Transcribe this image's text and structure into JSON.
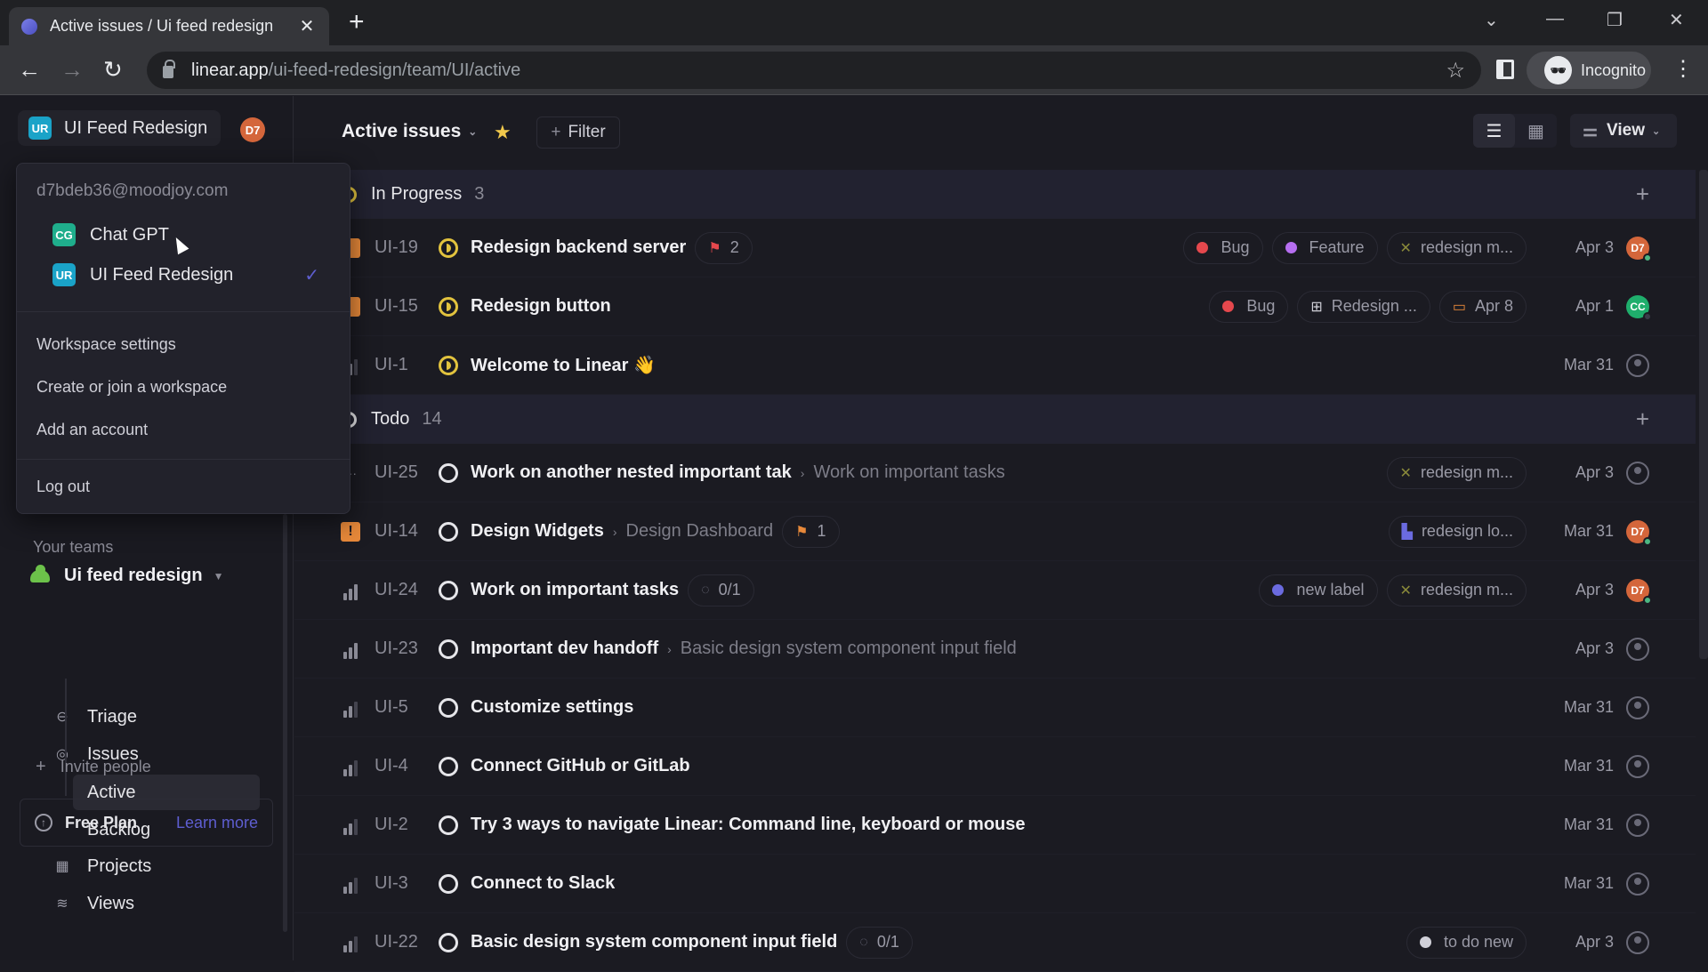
{
  "browser": {
    "tab_title": "Active issues / Ui feed redesign",
    "url_host": "linear.app",
    "url_path": "/ui-feed-redesign/team/UI/active",
    "profile_label": "Incognito"
  },
  "workspace": {
    "badge": "UR",
    "name": "UI Feed Redesign",
    "user_initials": "D7"
  },
  "workspace_menu": {
    "email": "d7bdeb36@moodjoy.com",
    "workspaces": [
      {
        "badge": "CG",
        "name": "Chat GPT",
        "color": "#1fae8c",
        "selected": false
      },
      {
        "badge": "UR",
        "name": "UI Feed Redesign",
        "color": "#1aa3c8",
        "selected": true
      }
    ],
    "items": [
      "Workspace settings",
      "Create or join a workspace",
      "Add an account",
      "Log out"
    ]
  },
  "sidebar": {
    "section_label": "Your teams",
    "team_name": "Ui feed redesign",
    "nav": [
      {
        "label": "Triage",
        "icon": "triage-icon"
      },
      {
        "label": "Issues",
        "icon": "issues-icon"
      }
    ],
    "sub_items": [
      {
        "label": "Active",
        "active": true
      },
      {
        "label": "Backlog",
        "active": false
      }
    ],
    "nav_more": [
      {
        "label": "Projects",
        "icon": "projects-icon"
      },
      {
        "label": "Views",
        "icon": "views-icon"
      }
    ],
    "invite_label": "Invite people",
    "plan_label": "Free Plan",
    "learn_more": "Learn more"
  },
  "toolbar": {
    "view_title": "Active issues",
    "filter_label": "Filter",
    "view_label": "View"
  },
  "groups": [
    {
      "name": "In Progress",
      "count": "3",
      "status_color": "#e2c33e",
      "issues": [
        {
          "id": "UI-19",
          "priority": "urgent",
          "status": "prog",
          "title": "Redesign backend server",
          "parent": "",
          "sub": {
            "icon": "milestone-flag",
            "text": "2",
            "color": "#e5484d"
          },
          "labels": [
            {
              "type": "dot",
              "color": "#e5484d",
              "text": "Bug"
            },
            {
              "type": "dot",
              "color": "#b66ef0",
              "text": "Feature"
            },
            {
              "type": "project",
              "text": "redesign m..."
            }
          ],
          "date": "Apr 3",
          "assignee": {
            "initials": "D7",
            "color": "#d4663b",
            "online": true
          }
        },
        {
          "id": "UI-15",
          "priority": "urgent",
          "status": "prog",
          "title": "Redesign button",
          "parent": "",
          "sub": null,
          "labels": [
            {
              "type": "dot",
              "color": "#e5484d",
              "text": "Bug"
            },
            {
              "type": "cycle",
              "text": "Redesign ..."
            },
            {
              "type": "due",
              "text": "Apr 8"
            }
          ],
          "date": "Apr 1",
          "assignee": {
            "initials": "CC",
            "color": "#1fae6c",
            "online": false
          }
        },
        {
          "id": "UI-1",
          "priority": "low",
          "status": "prog",
          "title": "Welcome to Linear 👋",
          "parent": "",
          "sub": null,
          "labels": [],
          "date": "Mar 31",
          "assignee": null
        }
      ]
    },
    {
      "name": "Todo",
      "count": "14",
      "status_color": "#e6e6ea",
      "issues": [
        {
          "id": "UI-25",
          "priority": "none",
          "status": "todo",
          "title": "Work on another nested important tak",
          "parent": "Work on important tasks",
          "sub": null,
          "labels": [
            {
              "type": "project",
              "text": "redesign m..."
            }
          ],
          "date": "Apr 3",
          "assignee": null
        },
        {
          "id": "UI-14",
          "priority": "urgent-bang",
          "status": "todo",
          "title": "Design Widgets",
          "parent": "Design Dashboard",
          "sub": {
            "icon": "milestone-flag",
            "text": "1",
            "color": "#e8893a"
          },
          "labels": [
            {
              "type": "doc",
              "text": "redesign lo..."
            }
          ],
          "date": "Mar 31",
          "assignee": {
            "initials": "D7",
            "color": "#d4663b",
            "online": true
          }
        },
        {
          "id": "UI-24",
          "priority": "medium",
          "status": "todo",
          "title": "Work on important tasks",
          "parent": "",
          "sub": {
            "icon": "progress-ring",
            "text": "0/1",
            "color": "#6a6a78"
          },
          "labels": [
            {
              "type": "dot",
              "color": "#6b6be0",
              "text": "new label"
            },
            {
              "type": "project",
              "text": "redesign m..."
            }
          ],
          "date": "Apr 3",
          "assignee": {
            "initials": "D7",
            "color": "#d4663b",
            "online": true
          }
        },
        {
          "id": "UI-23",
          "priority": "medium",
          "status": "todo",
          "title": "Important dev handoff",
          "parent": "Basic design system component input field",
          "sub": null,
          "labels": [],
          "date": "Apr 3",
          "assignee": null
        },
        {
          "id": "UI-5",
          "priority": "low",
          "status": "todo",
          "title": "Customize settings",
          "parent": "",
          "sub": null,
          "labels": [],
          "date": "Mar 31",
          "assignee": null
        },
        {
          "id": "UI-4",
          "priority": "low",
          "status": "todo",
          "title": "Connect GitHub or GitLab",
          "parent": "",
          "sub": null,
          "labels": [],
          "date": "Mar 31",
          "assignee": null
        },
        {
          "id": "UI-2",
          "priority": "low",
          "status": "todo",
          "title": "Try 3 ways to navigate Linear: Command line, keyboard or mouse",
          "parent": "",
          "sub": null,
          "labels": [],
          "date": "Mar 31",
          "assignee": null
        },
        {
          "id": "UI-3",
          "priority": "low",
          "status": "todo",
          "title": "Connect to Slack",
          "parent": "",
          "sub": null,
          "labels": [],
          "date": "Mar 31",
          "assignee": null
        },
        {
          "id": "UI-22",
          "priority": "low",
          "status": "todo",
          "title": "Basic design system component input field",
          "parent": "",
          "sub": {
            "icon": "progress-ring",
            "text": "0/1",
            "color": "#6a6a78"
          },
          "labels": [
            {
              "type": "dot",
              "color": "#d0d0d8",
              "text": "to do new"
            }
          ],
          "date": "Apr 3",
          "assignee": null
        }
      ]
    }
  ]
}
